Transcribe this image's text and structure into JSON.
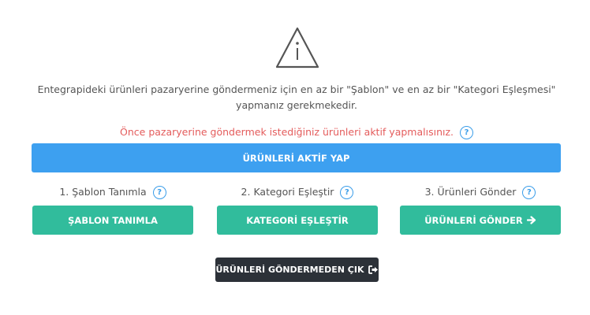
{
  "intro": {
    "line1": "Entegrapideki ürünleri  pazaryerine göndermeniz için en az bir \"Şablon\" ve en az bir \"Kategori Eşleşmesi\"",
    "line2": "yapmanız gerekmekedir."
  },
  "notice": {
    "text": "Önce  pazaryerine göndermek istediğiniz ürünleri aktif yapmalısınız.",
    "help": "?"
  },
  "activate_button": "ÜRÜNLERİ AKTİF YAP",
  "steps": [
    {
      "label": "1. Şablon Tanımla",
      "help": "?",
      "button": "ŞABLON TANIMLA"
    },
    {
      "label": "2. Kategori Eşleştir",
      "help": "?",
      "button": "KATEGORİ EŞLEŞTİR"
    },
    {
      "label": "3. Ürünleri Gönder",
      "help": "?",
      "button": "ÜRÜNLERİ GÖNDER"
    }
  ],
  "exit_button": "ÜRÜNLERİ GÖNDERMEDEN ÇIK",
  "icons": {
    "warning": "warning-triangle-icon",
    "help": "question-circle-icon",
    "arrow": "arrow-right-icon",
    "exit": "sign-out-icon"
  },
  "colors": {
    "blue": "#3da0f0",
    "green": "#31bc9c",
    "dark": "#2c3138",
    "notice_red": "#e45c5c",
    "help_blue": "#3a9de9"
  }
}
